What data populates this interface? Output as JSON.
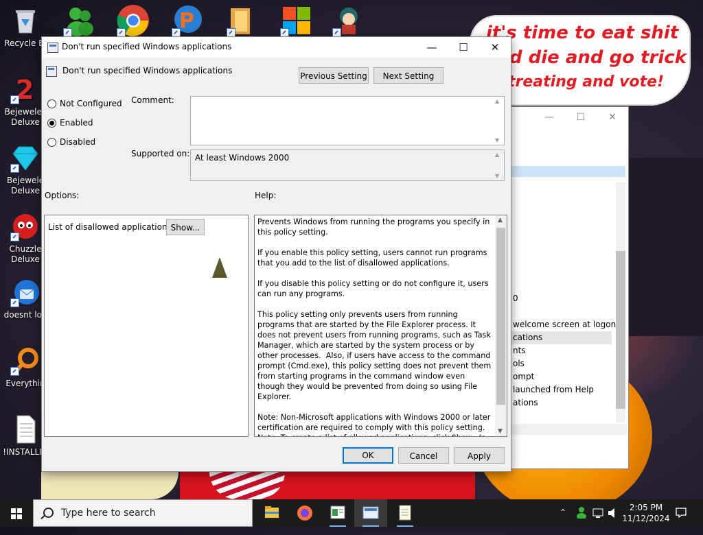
{
  "desktop": {
    "icons": [
      {
        "label": "Recycle Bi",
        "icon": "recycle-bin-icon"
      },
      {
        "label": "Bejewelec Deluxe",
        "icon": "bejeweled2-icon"
      },
      {
        "label": "Bejewele Deluxe",
        "icon": "bejeweled-icon"
      },
      {
        "label": "Chuzzle Deluxe",
        "icon": "chuzzle-icon"
      },
      {
        "label": "doesnt loa",
        "icon": "thunderbird-icon"
      },
      {
        "label": "Everythin",
        "icon": "everything-icon"
      },
      {
        "label": "!INSTALLIN",
        "icon": "text-document-icon"
      }
    ],
    "wallpaper_text": [
      "it's time to eat shit",
      "d die and go trick",
      "treating and vote!"
    ]
  },
  "background_window": {
    "items": [
      "0",
      "welcome screen at logon",
      "cations",
      "nts",
      "ols",
      "ompt",
      "launched from Help",
      "ations"
    ]
  },
  "dialog": {
    "title": "Don't run specified Windows applications",
    "header_title": "Don't run specified Windows applications",
    "prev_button": "Previous Setting",
    "next_button": "Next Setting",
    "radios": [
      {
        "label": "Not Configured",
        "checked": false
      },
      {
        "label": "Enabled",
        "checked": true
      },
      {
        "label": "Disabled",
        "checked": false
      }
    ],
    "comment_label": "Comment:",
    "comment_value": "",
    "supported_label": "Supported on:",
    "supported_value": "At least Windows 2000",
    "options_label": "Options:",
    "help_label": "Help:",
    "option_item_label": "List of disallowed applications",
    "show_button": "Show...",
    "help_text": "Prevents Windows from running the programs you specify in this policy setting.\n\nIf you enable this policy setting, users cannot run programs that you add to the list of disallowed applications.\n\nIf you disable this policy setting or do not configure it, users can run any programs.\n\nThis policy setting only prevents users from running programs that are started by the File Explorer process. It does not prevent users from running programs, such as Task Manager, which are started by the system process or by other processes.  Also, if users have access to the command prompt (Cmd.exe), this policy setting does not prevent them from starting programs in the command window even though they would be prevented from doing so using File Explorer.\n\nNote: Non-Microsoft applications with Windows 2000 or later certification are required to comply with this policy setting.\nNote: To create a list of allowed applications, click Show.  In the",
    "ok_button": "OK",
    "cancel_button": "Cancel",
    "apply_button": "Apply"
  },
  "taskbar": {
    "search_placeholder": "Type here to search",
    "apps": [
      "file-explorer-icon",
      "firefox-icon",
      "group-policy-editor-icon",
      "policy-dialog-icon",
      "notepad-icon"
    ],
    "time": "2:05 PM",
    "date": "11/12/2024"
  },
  "colors": {
    "accent": "#0078d7",
    "wallpaper_text": "#e01c24",
    "taskbar": "#1c1c1c"
  }
}
